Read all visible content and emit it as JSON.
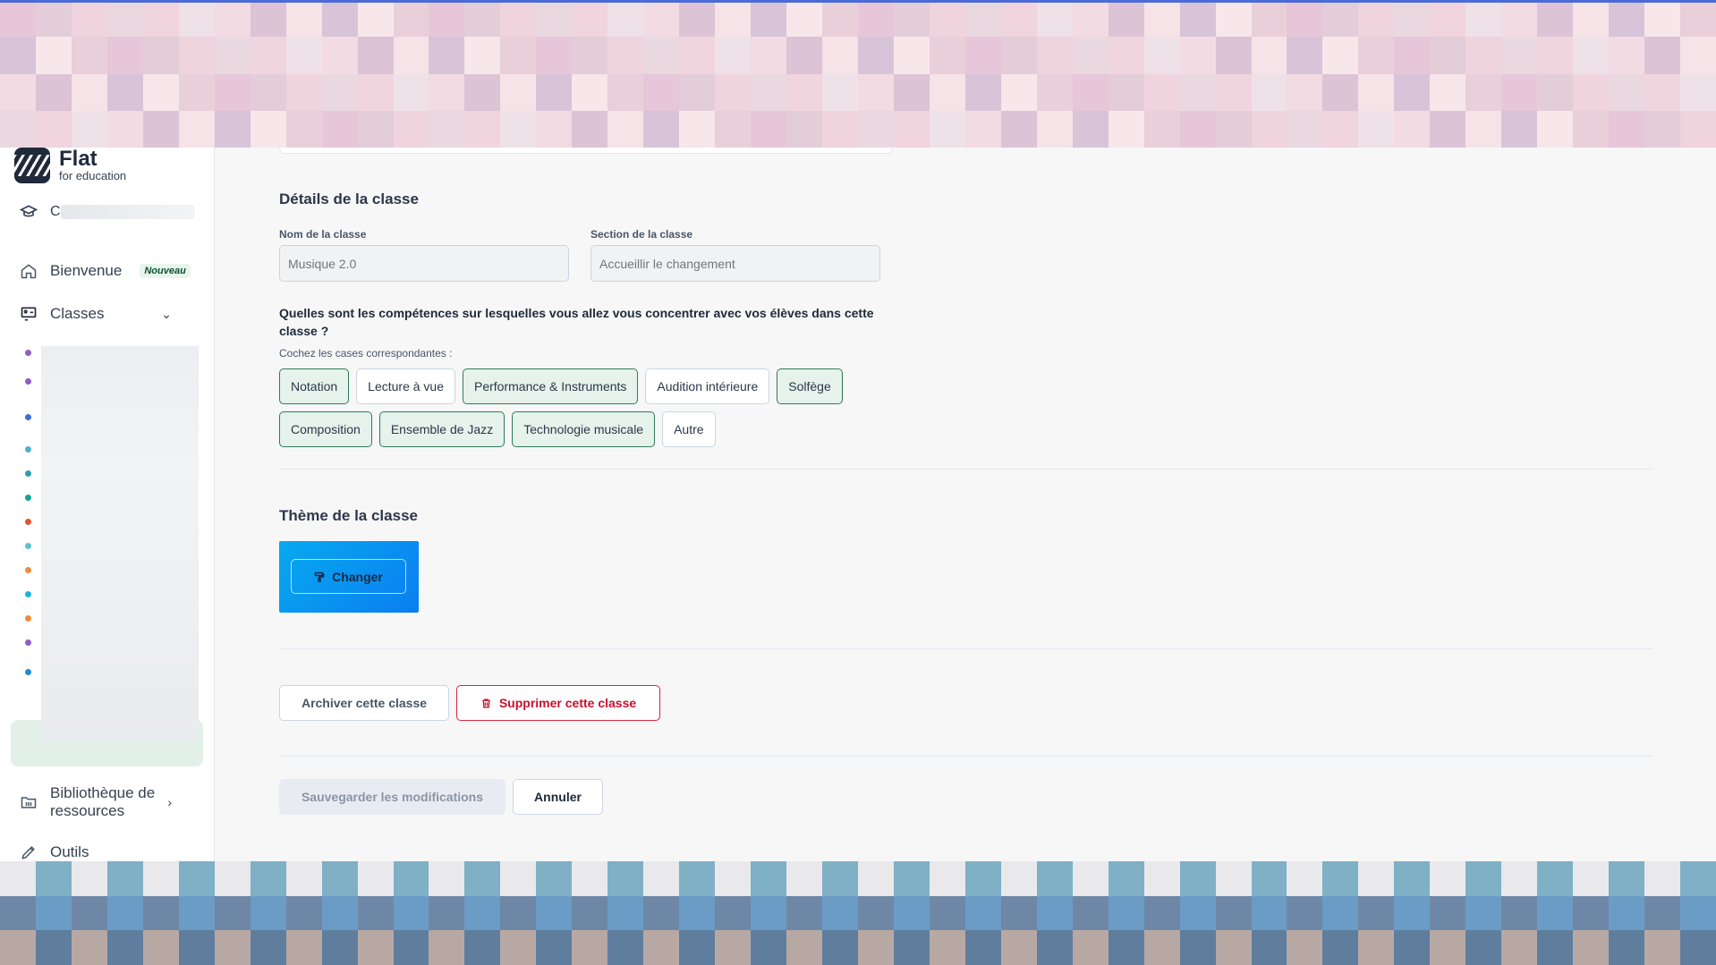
{
  "brand": {
    "name": "Flat",
    "subtitle": "for education"
  },
  "sidebar": {
    "school_icon": "graduation-cap-icon",
    "school_initial": "C",
    "welcome": {
      "label": "Bienvenue",
      "badge": "Nouveau"
    },
    "classes": {
      "label": "Classes"
    },
    "class_dot_colors": [
      "#8e5fbf",
      "#8e5fbf",
      "#3b6fd8",
      "#4fb3c8",
      "#2aa0b0",
      "#12a39a",
      "#e0542f",
      "#5cc3d0",
      "#f08a3a",
      "#1fb3d6",
      "#f08a3a",
      "#8e5fbf",
      "#1b8ad8"
    ],
    "library": {
      "label": "Bibliothèque de ressources"
    },
    "tools": {
      "label": "Outils"
    }
  },
  "details": {
    "title": "Détails de la classe",
    "name_label": "Nom de la classe",
    "name_placeholder": "Musique 2.0",
    "section_label": "Section de la classe",
    "section_placeholder": "Accueillir le changement",
    "question": "Quelles sont les compétences sur lesquelles vous allez vous concentrer avec vos élèves dans cette classe ?",
    "hint": "Cochez les cases correspondantes :",
    "skills": [
      {
        "label": "Notation",
        "selected": true
      },
      {
        "label": "Lecture à vue",
        "selected": false
      },
      {
        "label": "Performance & Instruments",
        "selected": true
      },
      {
        "label": "Audition intérieure",
        "selected": false
      },
      {
        "label": "Solfège",
        "selected": true
      },
      {
        "label": "Composition",
        "selected": true
      },
      {
        "label": "Ensemble de Jazz",
        "selected": true
      },
      {
        "label": "Technologie musicale",
        "selected": true
      },
      {
        "label": "Autre",
        "selected": false
      }
    ]
  },
  "theme": {
    "title": "Thème de la classe",
    "change_label": "Changer",
    "colors": [
      "#08a9f0",
      "#0a7ef0"
    ]
  },
  "actions": {
    "archive_label": "Archiver cette classe",
    "delete_label": "Supprimer cette classe",
    "save_label": "Sauvegarder les modifications",
    "cancel_label": "Annuler"
  },
  "colors": {
    "accent_selected_bg": "#e6f2ec",
    "accent_selected_border": "#2f7a5a",
    "danger": "#c8102e"
  }
}
